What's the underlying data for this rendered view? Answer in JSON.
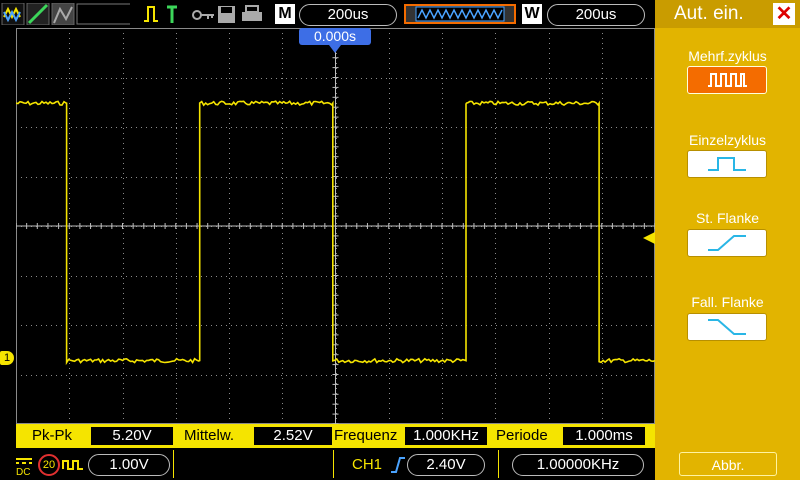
{
  "colors": {
    "trace": "#f5e400",
    "grid": "#8a8a8a",
    "sidebar": "#e2b400",
    "marker": "#3d6ee6",
    "active_button": "#f46c00"
  },
  "topbar": {
    "icons": [
      "waveform-mode-icon",
      "channel-icon",
      "grey-image-icon",
      "run-stop-icon",
      "trigger-icon",
      "key-icon",
      "save-icon",
      "print-icon"
    ],
    "timebase_letter": "M",
    "timebase": "200us",
    "window_letter": "W",
    "window_timebase": "200us"
  },
  "trigger_position": "0.000s",
  "channel_marker": "1",
  "measurements": [
    {
      "label": "Pk-Pk",
      "value": "5.20V"
    },
    {
      "label": "Mittelw.",
      "value": "2.52V"
    },
    {
      "label": "Frequenz",
      "value": "1.000KHz"
    },
    {
      "label": "Periode",
      "value": "1.000ms"
    }
  ],
  "bottombar": {
    "coupling": "DC",
    "bw_limit": "20",
    "volts_div": "1.00V",
    "trigger_source": "CH1",
    "trigger_level": "2.40V",
    "frequency": "1.00000KHz"
  },
  "sidebar": {
    "title": "Aut. ein.",
    "close": "✕",
    "items": [
      {
        "label": "Mehrf.zyklus",
        "icon": "multi-cycle-icon",
        "active": true
      },
      {
        "label": "Einzelzyklus",
        "icon": "single-cycle-icon",
        "active": false
      },
      {
        "label": "St. Flanke",
        "icon": "rising-edge-icon",
        "active": false
      },
      {
        "label": "Fall. Flanke",
        "icon": "falling-edge-icon",
        "active": false
      }
    ],
    "cancel": "Abbr."
  },
  "waveform": {
    "type": "square",
    "high_level_pct": 0.19,
    "low_level_pct": 0.84,
    "frequency_hz": 1000,
    "volts_per_div": 1.0,
    "time_per_div_s": 0.0002
  }
}
